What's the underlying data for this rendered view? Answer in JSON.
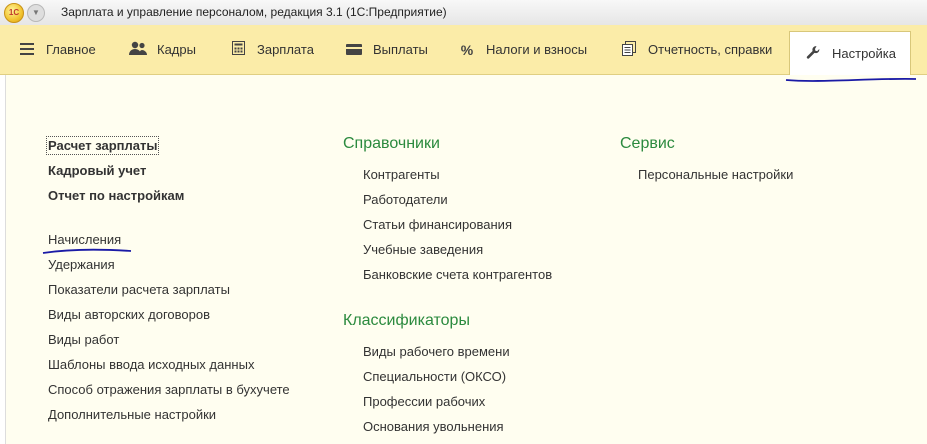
{
  "window": {
    "title": "Зарплата и управление персоналом, редакция 3.1  (1С:Предприятие)",
    "logo_text": "1С"
  },
  "sections": [
    {
      "label": "Главное",
      "icon": "menu-icon"
    },
    {
      "label": "Кадры",
      "icon": "people-icon"
    },
    {
      "label": "Зарплата",
      "icon": "calculator-icon"
    },
    {
      "label": "Выплаты",
      "icon": "card-icon"
    },
    {
      "label": "Налоги и взносы",
      "icon": "percent-icon"
    },
    {
      "label": "Отчетность, справки",
      "icon": "reports-icon"
    },
    {
      "label": "Настройка",
      "icon": "wrench-icon",
      "active": true
    }
  ],
  "columns": {
    "left": {
      "bold_items": [
        "Расчет зарплаты",
        "Кадровый учет",
        "Отчет по настройкам"
      ],
      "items": [
        "Начисления",
        "Удержания",
        "Показатели расчета зарплаты",
        "Виды авторских договоров",
        "Виды работ",
        "Шаблоны ввода исходных данных",
        "Способ отражения зарплаты в бухучете",
        "Дополнительные настройки"
      ]
    },
    "middle": {
      "group1": {
        "heading": "Справочники",
        "items": [
          "Контрагенты",
          "Работодатели",
          "Статьи финансирования",
          "Учебные заведения",
          "Банковские счета контрагентов"
        ]
      },
      "group2": {
        "heading": "Классификаторы",
        "items": [
          "Виды рабочего времени",
          "Специальности (ОКСО)",
          "Профессии рабочих",
          "Основания увольнения"
        ]
      }
    },
    "right": {
      "heading": "Сервис",
      "items": [
        "Персональные настройки"
      ]
    }
  },
  "colors": {
    "section_bg": "#fbeca8",
    "heading_green": "#2b8a3e",
    "annotation_blue": "#1a1aa6"
  }
}
